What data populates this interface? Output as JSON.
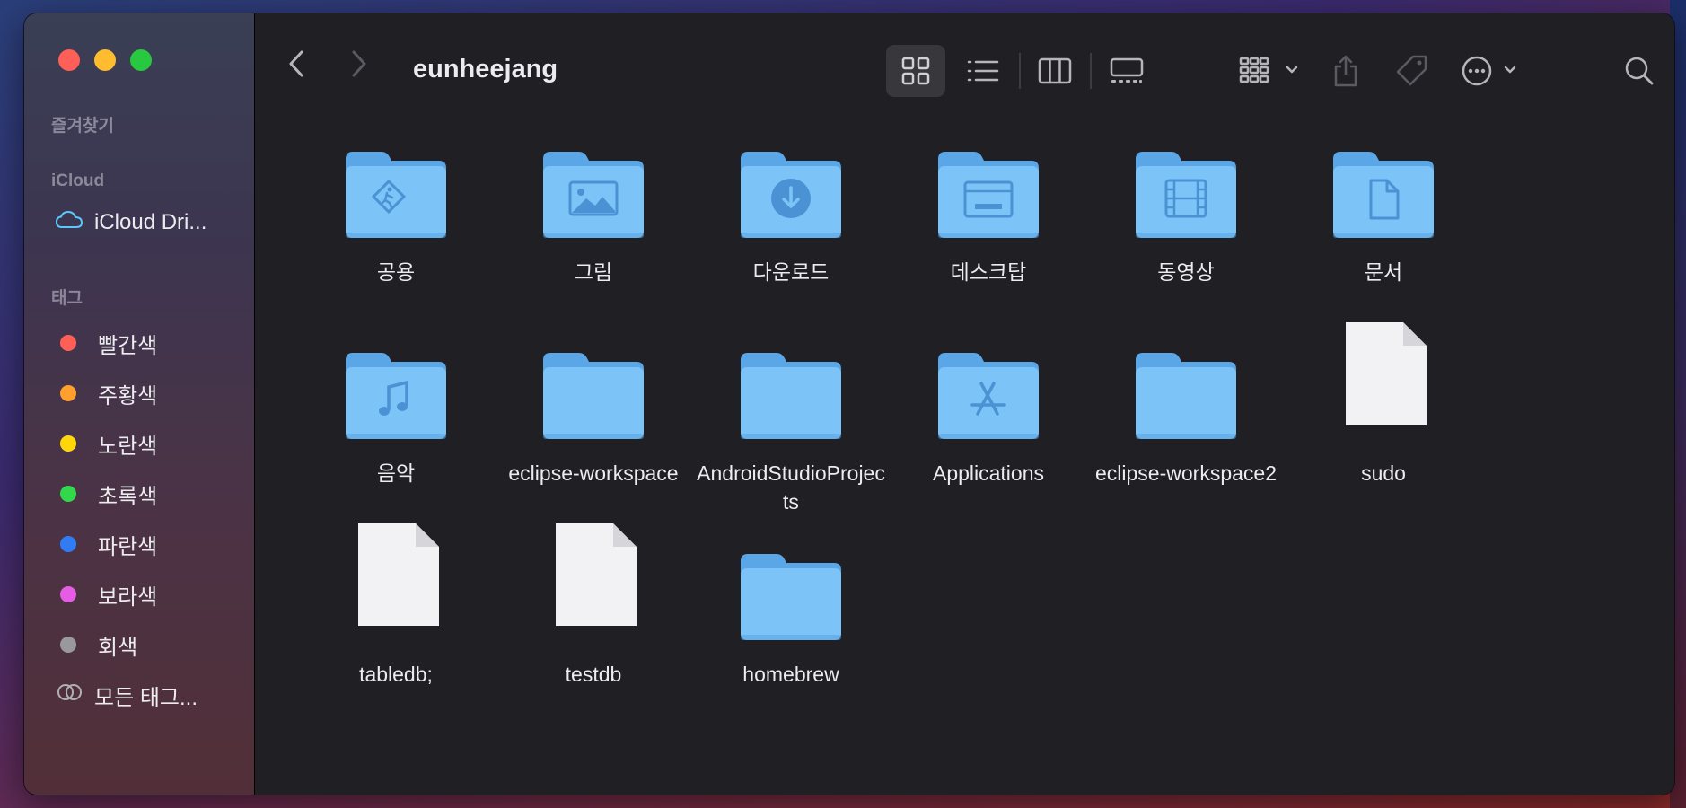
{
  "window": {
    "title": "eunheejang"
  },
  "sidebar": {
    "favorites_header": "즐겨찾기",
    "icloud_header": "iCloud",
    "icloud_drive": "iCloud Dri...",
    "tags_header": "태그",
    "tags": [
      {
        "label": "빨간색",
        "color": "#ff5f57"
      },
      {
        "label": "주황색",
        "color": "#ff9f2e"
      },
      {
        "label": "노란색",
        "color": "#ffd60a"
      },
      {
        "label": "초록색",
        "color": "#32d74b"
      },
      {
        "label": "파란색",
        "color": "#2f7cf6"
      },
      {
        "label": "보라색",
        "color": "#e45de4"
      },
      {
        "label": "회색",
        "color": "#98989d"
      }
    ],
    "all_tags": "모든 태그..."
  },
  "toolbar": {
    "icons": [
      "back-icon",
      "forward-icon",
      "icon-view-icon",
      "list-view-icon",
      "column-view-icon",
      "gallery-view-icon",
      "group-icon",
      "share-icon",
      "tag-icon",
      "more-icon",
      "search-icon"
    ]
  },
  "items": [
    {
      "name": "공용",
      "kind": "folder",
      "glyph": "public"
    },
    {
      "name": "그림",
      "kind": "folder",
      "glyph": "pictures"
    },
    {
      "name": "다운로드",
      "kind": "folder",
      "glyph": "downloads"
    },
    {
      "name": "데스크탑",
      "kind": "folder",
      "glyph": "desktop"
    },
    {
      "name": "동영상",
      "kind": "folder",
      "glyph": "movies"
    },
    {
      "name": "문서",
      "kind": "folder",
      "glyph": "documents"
    },
    {
      "name": "음악",
      "kind": "folder",
      "glyph": "music"
    },
    {
      "name": "eclipse-workspace",
      "kind": "folder",
      "glyph": "none"
    },
    {
      "name": "AndroidStudioProjects",
      "kind": "folder",
      "glyph": "none"
    },
    {
      "name": "Applications",
      "kind": "folder",
      "glyph": "applications"
    },
    {
      "name": "eclipse-workspace2",
      "kind": "folder",
      "glyph": "none"
    },
    {
      "name": "sudo",
      "kind": "file",
      "glyph": "none"
    },
    {
      "name": "tabledb;",
      "kind": "file",
      "glyph": "none"
    },
    {
      "name": "testdb",
      "kind": "file",
      "glyph": "none"
    },
    {
      "name": "homebrew",
      "kind": "folder",
      "glyph": "none"
    }
  ],
  "colors": {
    "folder": "#7cc4f7",
    "folder_dark": "#5aa6e6",
    "window_bg": "#202024"
  }
}
